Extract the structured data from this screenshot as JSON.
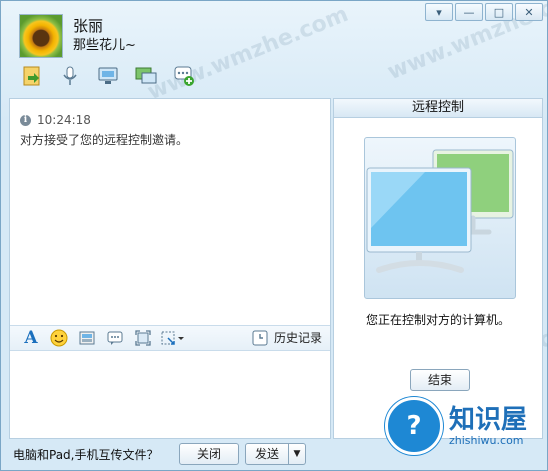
{
  "window": {
    "controls": {
      "menu": "▾",
      "minimize": "—",
      "maximize": "□",
      "close": "✕"
    }
  },
  "contact": {
    "name": "张丽",
    "status": "那些花儿~"
  },
  "toolbar": {
    "icons": [
      "send-file-icon",
      "voice-call-icon",
      "video-call-icon",
      "remote-desktop-icon",
      "add-chat-icon"
    ]
  },
  "chat": {
    "messages": [
      {
        "time": "10:24:18",
        "text": "对方接受了您的远程控制邀请。"
      }
    ],
    "info_glyph": "i"
  },
  "input_toolbar": {
    "font_label": "A",
    "history_label": "历史记录"
  },
  "remote_panel": {
    "title": "远程控制",
    "status": "您正在控制对方的计算机。",
    "end_label": "结束"
  },
  "bottom_bar": {
    "transfer_tip": "电脑和Pad,手机互传文件？",
    "close_label": "关闭",
    "send_label": "发送",
    "send_arrow": "▼"
  },
  "watermarks": [
    "www.wmzhe.com",
    "www.wmzhe.com",
    "www.wmzhe.com",
    "www.wmzhe.com",
    "www.wmzhe.com",
    "www.wmzhe.com"
  ],
  "logo": {
    "main": "知识屋",
    "sub": "zhishiwu.com",
    "glyph": "?"
  },
  "colors": {
    "window_bg": "#d6e9f6",
    "border": "#7aa6c6",
    "accent_blue": "#1e88d4"
  }
}
